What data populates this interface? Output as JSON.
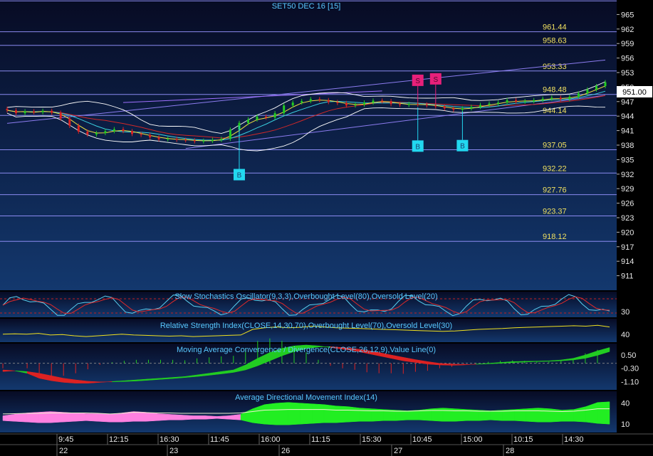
{
  "colors": {
    "bg_top": "#0a0f2e",
    "bg_bottom": "#12346a",
    "level_line": "#8a8af0",
    "level_text": "#f0e060",
    "axis_text": "#e8e8e8",
    "title_text": "#58c8ff",
    "up": "#22cc22",
    "down": "#dd2222",
    "buy_marker": "#22d8f0",
    "sell_marker": "#e8207a",
    "price_label_bg": "#ffffff",
    "stoch_k": "#5ad0f0",
    "stoch_d": "#e02a2a",
    "rsi_line": "#f0e020",
    "adx_up": "#22ee22",
    "adx_down": "#ff80e0"
  },
  "chart_data": [
    {
      "type": "candlestick",
      "title": "SET50 DEC 16  [15]",
      "ylim": [
        908,
        968
      ],
      "y_ticks": [
        965,
        962,
        959,
        956,
        953,
        950,
        947,
        944,
        941,
        938,
        935,
        932,
        929,
        926,
        923,
        920,
        917,
        914,
        911
      ],
      "levels": [
        "967.81",
        "961.44",
        "958.63",
        "953.33",
        "948.48",
        "944.14",
        "937.05",
        "932.22",
        "927.76",
        "923.37",
        "918.12"
      ],
      "last_price": "951.00",
      "close_series": [
        945.2,
        944.6,
        945.0,
        944.8,
        945.1,
        944.7,
        943.5,
        942.0,
        940.8,
        940.2,
        940.5,
        940.9,
        941.3,
        940.9,
        940.3,
        940.1,
        939.6,
        939.2,
        939.3,
        939.1,
        939.0,
        938.8,
        938.9,
        939.1,
        939.3,
        941.2,
        942.6,
        943.3,
        943.9,
        943.7,
        944.6,
        946.2,
        946.8,
        947.1,
        947.5,
        947.3,
        946.9,
        946.7,
        946.2,
        946.4,
        946.8,
        947.2,
        947.1,
        946.5,
        946.3,
        946.5,
        946.4,
        946.2,
        946.0,
        945.6,
        945.3,
        945.6,
        945.9,
        946.3,
        946.6,
        946.8,
        947.3,
        947.0,
        947.1,
        947.3,
        947.6,
        947.8,
        947.5,
        948.0,
        948.7,
        949.5,
        950.2,
        951.0
      ],
      "buy_signals": [
        {
          "index": 26,
          "price": 931.9,
          "label": "B"
        },
        {
          "index": 46,
          "price": 937.8,
          "label": "B"
        },
        {
          "index": 51,
          "price": 937.9,
          "label": "B"
        }
      ],
      "sell_signals": [
        {
          "index": 46,
          "price": 951.4,
          "label": "S"
        },
        {
          "index": 48,
          "price": 951.7,
          "label": "S"
        }
      ]
    },
    {
      "type": "line",
      "title": "Slow Stochastics Oscillator(9,3,3),Overbought Level(80),Oversold Level(20)",
      "ylim": [
        0,
        100
      ],
      "y_ticks": [
        30
      ],
      "overbought": 80,
      "oversold": 20
    },
    {
      "type": "line",
      "title": "Relative Strength Index(CLOSE,14,30,70),Overbought Level(70),Oversold Level(30)",
      "ylim": [
        20,
        75
      ],
      "y_ticks": [
        40
      ],
      "values": [
        40,
        41,
        40,
        42,
        38,
        39,
        36,
        34,
        36,
        38,
        40,
        38,
        37,
        36,
        35,
        36,
        34,
        35,
        36,
        37,
        38,
        52,
        56,
        58,
        56,
        57,
        60,
        58,
        56,
        55,
        54,
        53,
        52,
        51,
        50,
        49,
        48,
        47,
        48,
        50,
        52,
        53,
        54,
        56,
        57,
        58,
        59,
        60,
        61,
        60,
        62,
        58
      ]
    },
    {
      "type": "area",
      "title": "Moving Average Convergence / Divergence(CLOSE,26,12,9),Value Line(0)",
      "ylim": [
        -1.6,
        1.1
      ],
      "y_ticks": [
        "0.50",
        "-0.30",
        "-1.10"
      ],
      "macd": [
        -0.5,
        -0.45,
        -0.6,
        -0.9,
        -1.05,
        -1.15,
        -1.2,
        -1.2,
        -1.15,
        -1.1,
        -1.05,
        -1.0,
        -0.95,
        -0.9,
        -0.85,
        -0.8,
        -0.7,
        -0.6,
        -0.5,
        -0.4,
        -0.1,
        0.3,
        0.65,
        0.9,
        1.05,
        1.1,
        1.05,
        0.95,
        0.85,
        0.75,
        0.6,
        0.45,
        0.3,
        0.15,
        0.05,
        -0.05,
        -0.1,
        -0.12,
        -0.1,
        -0.05,
        0.0,
        0.05,
        0.1,
        0.12,
        0.13,
        0.15,
        0.2,
        0.3,
        0.5,
        0.75,
        0.95
      ],
      "signal": [
        -0.4,
        -0.45,
        -0.5,
        -0.6,
        -0.75,
        -0.9,
        -1.0,
        -1.08,
        -1.12,
        -1.12,
        -1.1,
        -1.07,
        -1.02,
        -0.97,
        -0.92,
        -0.86,
        -0.8,
        -0.72,
        -0.64,
        -0.55,
        -0.4,
        -0.15,
        0.15,
        0.45,
        0.7,
        0.88,
        0.98,
        1.0,
        0.95,
        0.88,
        0.78,
        0.65,
        0.5,
        0.36,
        0.22,
        0.1,
        0.0,
        -0.05,
        -0.07,
        -0.06,
        -0.03,
        0.0,
        0.04,
        0.07,
        0.1,
        0.12,
        0.15,
        0.2,
        0.3,
        0.48,
        0.7
      ]
    },
    {
      "type": "area",
      "title": "Average Directional Movement Index(14)",
      "ylim": [
        0,
        55
      ],
      "y_ticks": [
        40,
        10
      ],
      "upper": [
        22,
        24,
        26,
        27,
        28,
        27,
        26,
        25,
        25,
        24,
        26,
        28,
        27,
        25,
        24,
        23,
        22,
        22,
        21,
        22,
        24,
        32,
        38,
        40,
        41,
        40,
        39,
        38,
        36,
        35,
        33,
        32,
        31,
        30,
        29,
        30,
        32,
        33,
        32,
        31,
        30,
        29,
        30,
        31,
        32,
        33,
        32,
        30,
        31,
        35,
        41,
        42
      ],
      "lower": [
        15,
        14,
        13,
        12,
        12,
        13,
        14,
        15,
        14,
        13,
        13,
        14,
        14,
        15,
        16,
        16,
        17,
        17,
        18,
        17,
        16,
        12,
        10,
        9,
        9,
        10,
        11,
        12,
        12,
        13,
        14,
        14,
        15,
        15,
        16,
        16,
        15,
        14,
        14,
        15,
        15,
        16,
        15,
        15,
        14,
        13,
        13,
        14,
        14,
        13,
        11,
        10
      ],
      "dominant_up": [
        false,
        false,
        false,
        false,
        false,
        false,
        false,
        false,
        false,
        false,
        false,
        false,
        false,
        false,
        false,
        false,
        false,
        false,
        false,
        false,
        true,
        true,
        true,
        true,
        true,
        true,
        true,
        true,
        true,
        true,
        true,
        true,
        true,
        true,
        true,
        true,
        true,
        true,
        true,
        true,
        true,
        true,
        true,
        true,
        true,
        true,
        true,
        true,
        true,
        true,
        true,
        true
      ]
    }
  ],
  "time_axis": {
    "times": [
      "9:45",
      "12:15",
      "16:30",
      "11:45",
      "16:00",
      "11:15",
      "15:30",
      "10:45",
      "15:00",
      "10:15",
      "14:30"
    ],
    "dates": [
      "22",
      "23",
      "26",
      "27",
      "28"
    ]
  }
}
